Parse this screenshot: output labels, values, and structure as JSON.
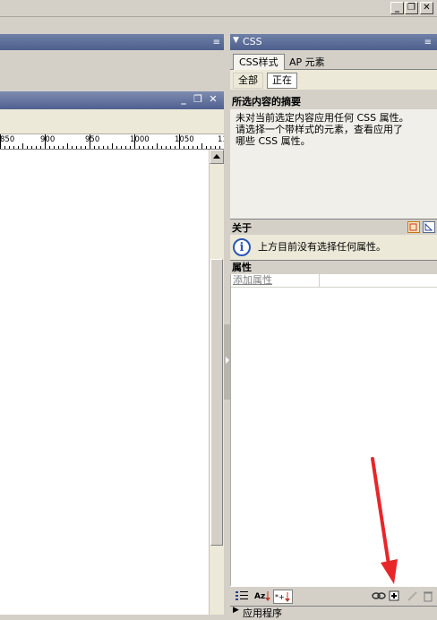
{
  "window": {
    "minimize_glyph": "_",
    "restore_glyph": "❐",
    "close_glyph": "✕"
  },
  "document": {
    "minimize_glyph": "_",
    "restore_glyph": "❐",
    "close_glyph": "✕",
    "ruler_labels": [
      "850",
      "900",
      "950",
      "1000",
      "1050",
      "11"
    ]
  },
  "css_panel": {
    "title": "CSS",
    "collapse_glyph": "▼",
    "tabs": [
      "CSS样式",
      "AP 元素"
    ],
    "modes": [
      "全部",
      "正在"
    ],
    "summary_heading": "所选内容的摘要",
    "summary_lines": [
      "未对当前选定内容应用任何 CSS 属性。",
      "请选择一个带样式的元素，查看应用了",
      "哪些 CSS 属性。"
    ],
    "about_heading": "关于",
    "about_text": "上方目前没有选择任何属性。",
    "properties_heading": "属性",
    "add_property": "添加属性",
    "next_panel": "应用程序",
    "next_panel_glyph": "▶"
  },
  "icons": {
    "info": "i",
    "options": "≡"
  },
  "colors": {
    "panel_header": "#4d5f8c",
    "chrome": "#d4d0c8",
    "annotation_arrow": "#e8262a"
  }
}
